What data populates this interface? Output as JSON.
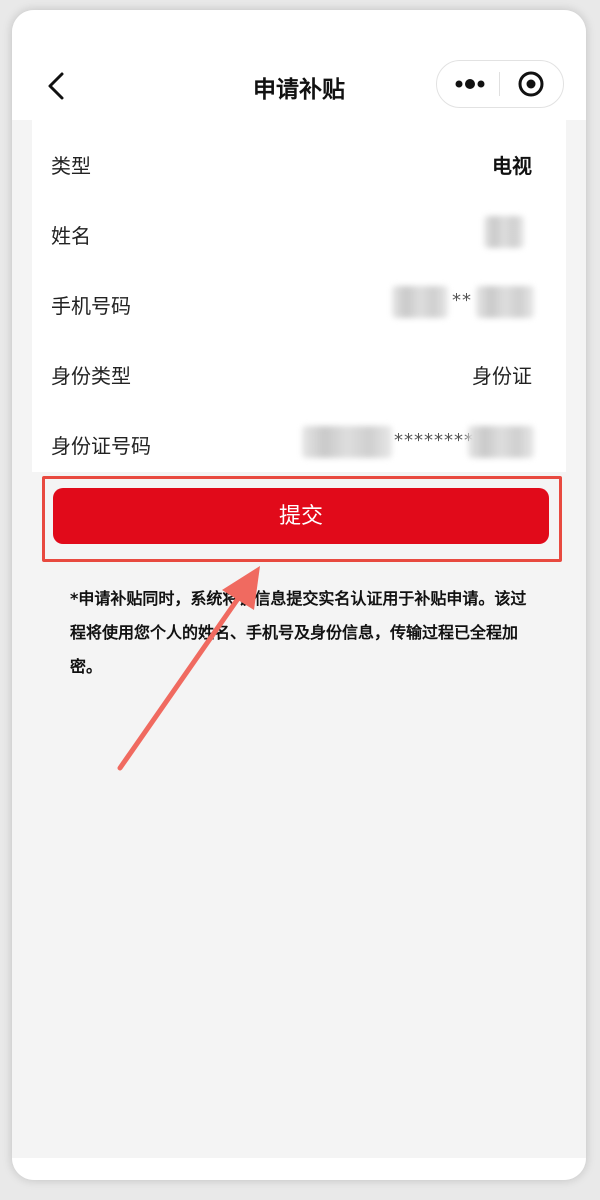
{
  "nav": {
    "title": "申请补贴"
  },
  "form": {
    "rows": [
      {
        "label": "类型",
        "value": "电视"
      },
      {
        "label": "姓名",
        "value": ""
      },
      {
        "label": "手机号码",
        "value_visible": "**"
      },
      {
        "label": "身份类型",
        "value": "身份证"
      },
      {
        "label": "身份证号码",
        "value_visible": "********"
      }
    ]
  },
  "submit": {
    "label": "提交"
  },
  "notice": {
    "text": "*申请补贴同时，系统将该信息提交实名认证用于补贴申请。该过程将使用您个人的姓名、手机号及身份信息，传输过程已全程加密。"
  },
  "colors": {
    "primary": "#e10a1a",
    "annotation": "#e8493f"
  }
}
